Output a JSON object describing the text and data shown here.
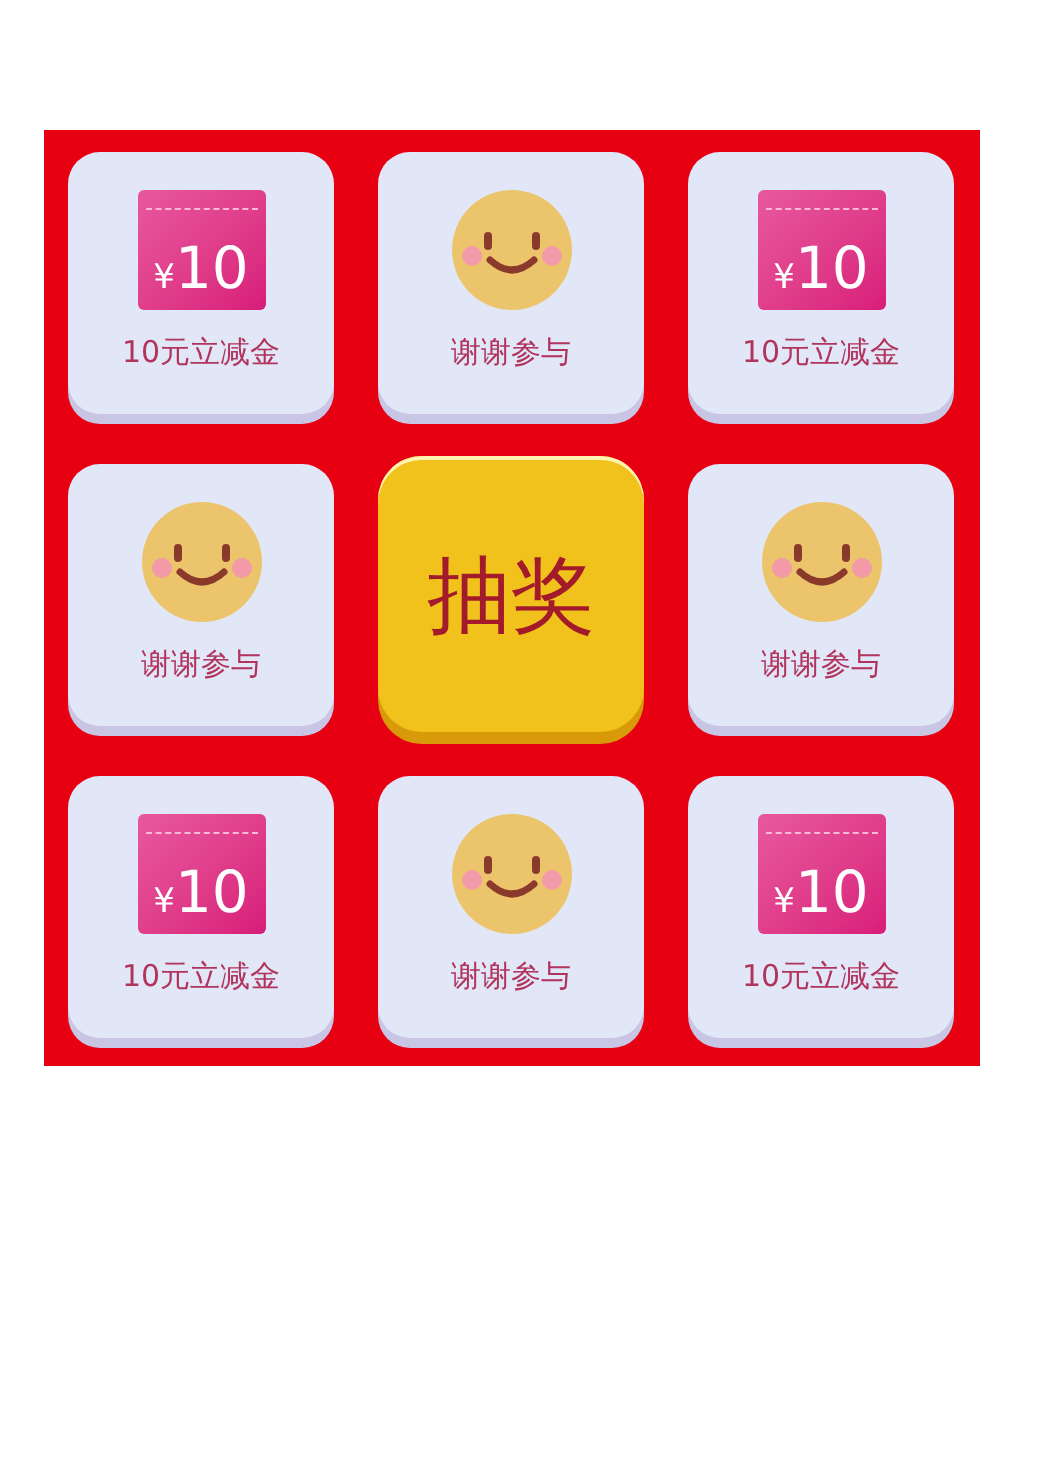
{
  "cells": [
    {
      "kind": "coupon",
      "currency": "¥",
      "amount": "10",
      "label": "10元立减金"
    },
    {
      "kind": "thanks",
      "label": "谢谢参与"
    },
    {
      "kind": "coupon",
      "currency": "¥",
      "amount": "10",
      "label": "10元立减金"
    },
    {
      "kind": "thanks",
      "label": "谢谢参与"
    },
    {
      "kind": "draw",
      "label": "抽奖"
    },
    {
      "kind": "thanks",
      "label": "谢谢参与"
    },
    {
      "kind": "coupon",
      "currency": "¥",
      "amount": "10",
      "label": "10元立减金"
    },
    {
      "kind": "thanks",
      "label": "谢谢参与"
    },
    {
      "kind": "coupon",
      "currency": "¥",
      "amount": "10",
      "label": "10元立减金"
    }
  ]
}
